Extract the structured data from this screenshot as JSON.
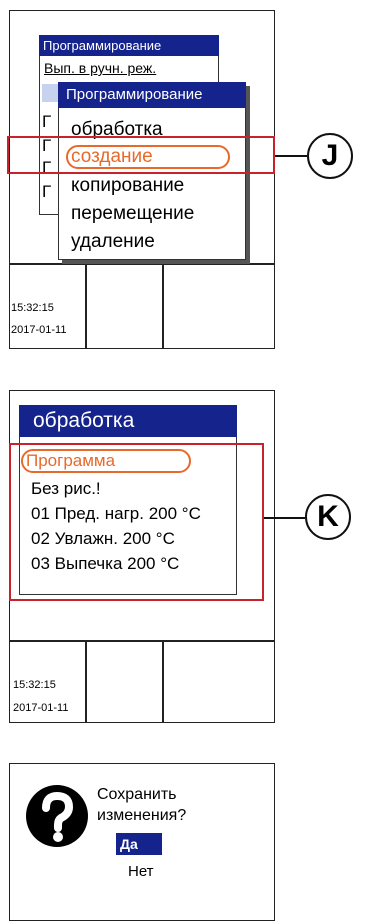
{
  "screen1": {
    "back_menu": {
      "title": "Программирование",
      "item": "Вып. в ручн. реж."
    },
    "popup": {
      "title": "Программирование",
      "items": [
        "обработка",
        "создание",
        "копирование",
        "перемещение",
        "удаление"
      ],
      "selected_index": 1
    },
    "time": "15:32:15",
    "date": "2017-01-11",
    "callout": "J"
  },
  "screen2": {
    "title": "обработка",
    "lines": [
      "Программа",
      "Без рис.!",
      "01 Пред. нагр. 200 °C",
      "02 Увлажн. 200 °C",
      "03 Выпечка 200 °C"
    ],
    "selected_index": 0,
    "time": "15:32:15",
    "date": "2017-01-11",
    "callout": "K"
  },
  "dialog": {
    "icon": "question-icon",
    "message_line1": "Сохранить",
    "message_line2": "изменения?",
    "yes": "Да",
    "no": "Нет"
  },
  "colors": {
    "title_bar": "#15238c",
    "highlight_oval": "#e86a2a",
    "annotation_box": "#c8232c"
  }
}
